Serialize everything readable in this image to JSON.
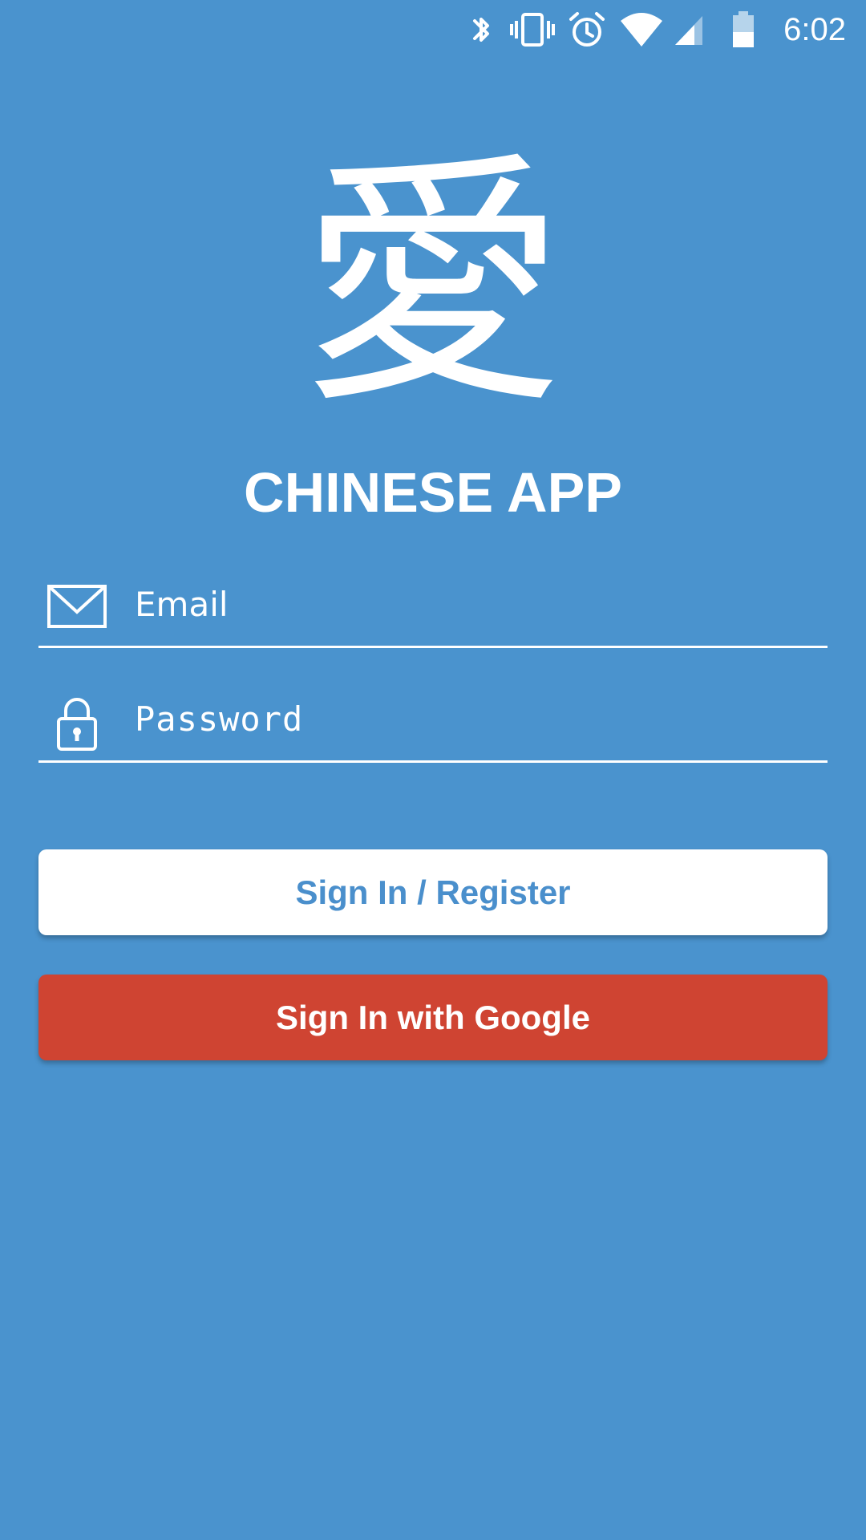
{
  "status_bar": {
    "time": "6:02",
    "icons": [
      "bluetooth-icon",
      "vibrate-icon",
      "alarm-icon",
      "wifi-icon",
      "cell-signal-icon",
      "battery-icon"
    ]
  },
  "logo": {
    "glyph": "愛"
  },
  "app_title": "CHINESE APP",
  "form": {
    "email_placeholder": "Email",
    "password_placeholder": "Password"
  },
  "buttons": {
    "signin_label": "Sign In / Register",
    "google_label": "Sign In with Google"
  },
  "colors": {
    "background": "#4a93ce",
    "primary_text": "#ffffff",
    "signin_button_bg": "#ffffff",
    "signin_button_text": "#4a8fcc",
    "google_button_bg": "#cf4432"
  }
}
